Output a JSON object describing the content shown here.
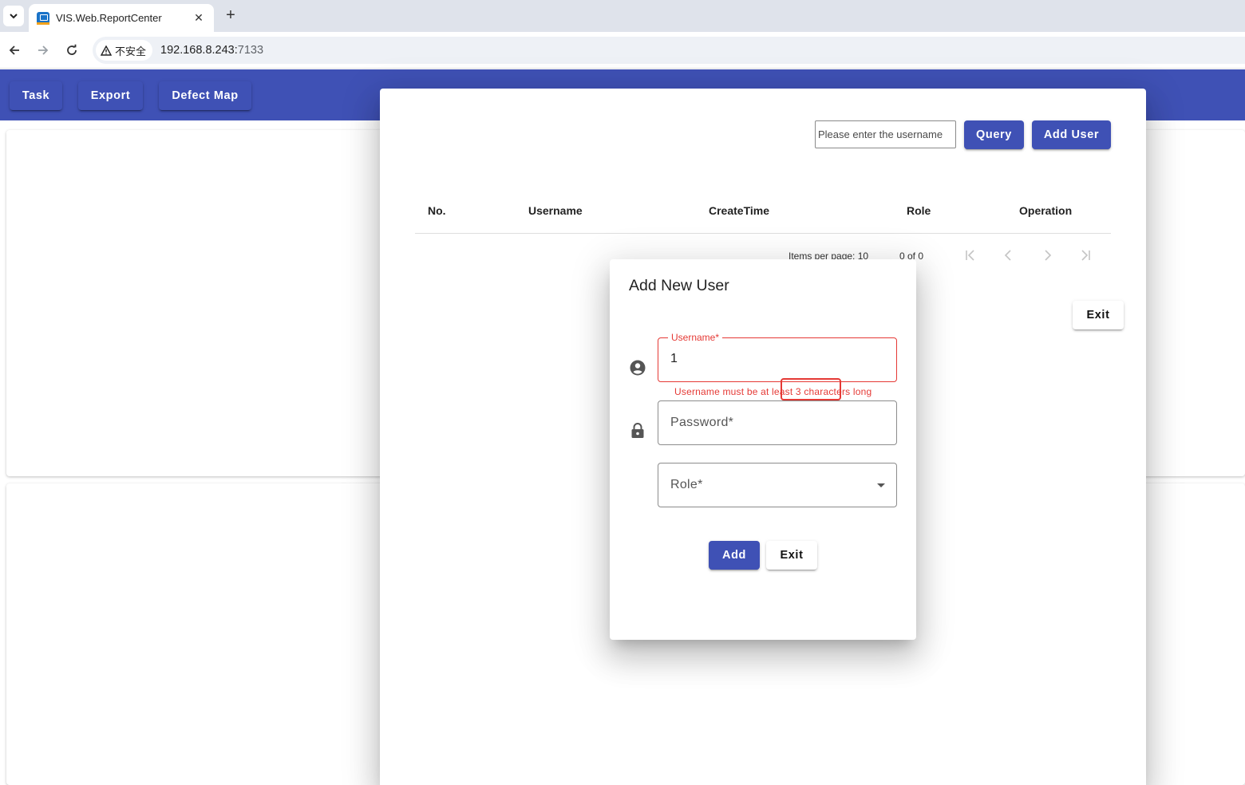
{
  "browser": {
    "tab_title": "VIS.Web.ReportCenter",
    "tab_close": "✕",
    "new_tab": "+",
    "security_label": "不安全",
    "url_host": "192.168.8.243:",
    "url_port": "7133"
  },
  "app_nav": {
    "task_label": "Task",
    "export_label": "Export",
    "defect_map_label": "Defect Map"
  },
  "user_panel": {
    "search": {
      "placeholder": "Please enter the username",
      "value": ""
    },
    "query_label": "Query",
    "add_user_label": "Add User",
    "columns": [
      "No.",
      "Username",
      "CreateTime",
      "Role",
      "Operation"
    ],
    "paginator": {
      "items_per_page_label": "Items per page:",
      "items_per_page_value": "10",
      "range_label": "0 of 0"
    },
    "exit_label": "Exit"
  },
  "dialog": {
    "title": "Add New User",
    "username": {
      "label": "Username*",
      "value": "1",
      "error": "Username must be at least 3 characters long"
    },
    "password": {
      "placeholder": "Password*",
      "value": ""
    },
    "role": {
      "placeholder": "Role*",
      "value": ""
    },
    "add_label": "Add",
    "exit_label": "Exit"
  },
  "colors": {
    "primary": "#3f51b5",
    "error": "#e53935",
    "chrome_bg": "#dfe3eb"
  },
  "icons": {
    "tab_list": "chevron-down-icon",
    "back": "arrow-left-icon",
    "forward": "arrow-right-icon",
    "reload": "reload-icon",
    "security": "warning-triangle-icon",
    "username_field": "account-circle-icon",
    "password_field": "lock-icon",
    "role_field": "dropdown-arrow-icon",
    "first_page": "first-page-icon",
    "previous_page": "chevron-left-icon",
    "next_page": "chevron-right-icon",
    "last_page": "last-page-icon"
  }
}
